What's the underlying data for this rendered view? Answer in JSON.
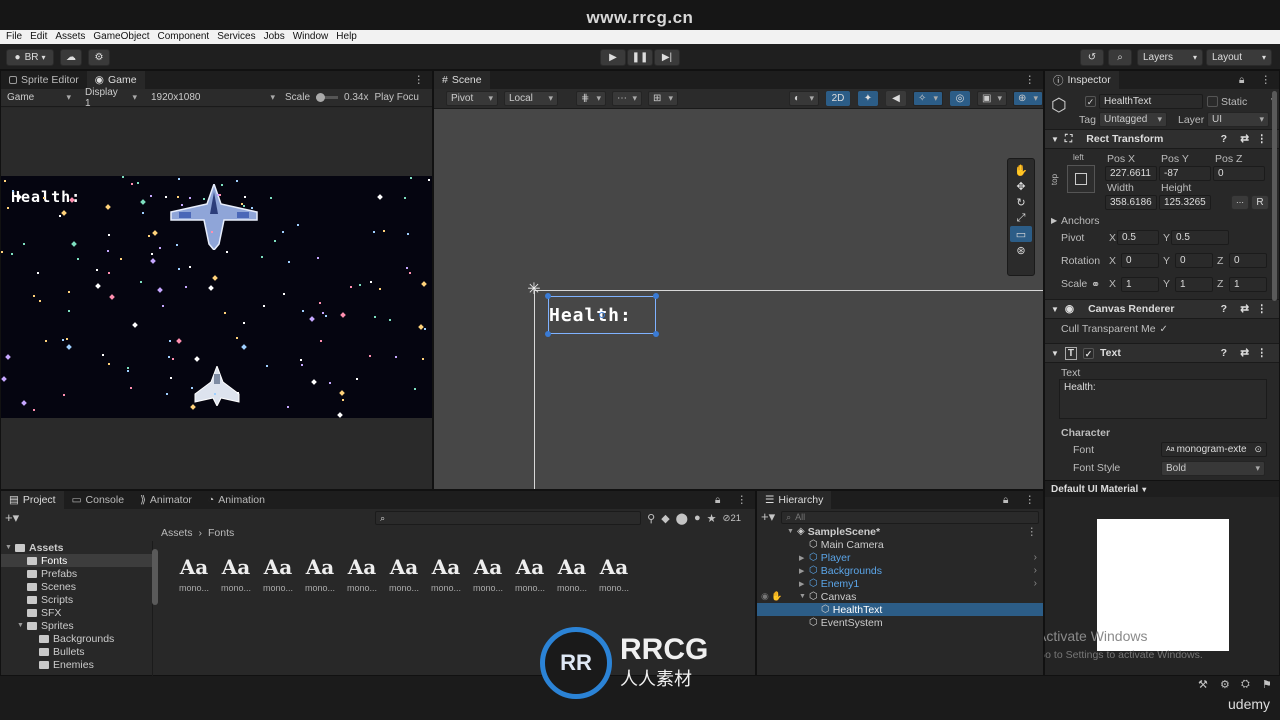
{
  "watermark": {
    "url": "www.rrcg.cn",
    "brand_title": "RRCG",
    "brand_sub": "人人素材",
    "udemy": "udemy"
  },
  "menu": [
    "File",
    "Edit",
    "Assets",
    "GameObject",
    "Component",
    "Services",
    "Jobs",
    "Window",
    "Help"
  ],
  "toolbar": {
    "account": "BR",
    "layers": "Layers",
    "layout": "Layout"
  },
  "game_panel": {
    "tabs": [
      "Sprite Editor",
      "Game"
    ],
    "mode": "Game",
    "display": "Display 1",
    "resolution": "1920x1080",
    "scale_label": "Scale",
    "scale_value": "0.34x",
    "play_focus": "Play Focu",
    "health_text": "Health:"
  },
  "scene_panel": {
    "tab": "Scene",
    "pivot": "Pivot",
    "local": "Local",
    "mode_2d": "2D",
    "health_text": "Health:"
  },
  "inspector": {
    "tab": "Inspector",
    "object_name": "HealthText",
    "static_label": "Static",
    "tag_label": "Tag",
    "tag_value": "Untagged",
    "layer_label": "Layer",
    "layer_value": "UI",
    "rect_transform": {
      "title": "Rect Transform",
      "anchor_h": "left",
      "anchor_v": "top",
      "pos_x_label": "Pos X",
      "pos_y_label": "Pos Y",
      "pos_z_label": "Pos Z",
      "pos_x": "227.6611",
      "pos_y": "-87",
      "pos_z": "0",
      "width_label": "Width",
      "height_label": "Height",
      "width": "358.6186",
      "height": "125.3265",
      "anchors": "Anchors",
      "pivot": "Pivot",
      "pivot_x": "0.5",
      "pivot_y": "0.5",
      "rotation": "Rotation",
      "rot_x": "0",
      "rot_y": "0",
      "rot_z": "0",
      "scale": "Scale",
      "scale_x": "1",
      "scale_y": "1",
      "scale_z": "1",
      "x": "X",
      "y": "Y",
      "z": "Z",
      "r": "R"
    },
    "canvas_renderer": {
      "title": "Canvas Renderer",
      "cull": "Cull Transparent Me"
    },
    "text": {
      "title": "Text",
      "text_label": "Text",
      "text_value": "Health:",
      "character": "Character",
      "font_label": "Font",
      "font_value": "monogram-exte",
      "font_style_label": "Font Style",
      "font_style_value": "Bold"
    },
    "default_material": "Default UI Material",
    "activate_title": "Activate Windows",
    "activate_sub": "Go to Settings to activate Windows."
  },
  "project_panel": {
    "tabs": [
      "Project",
      "Console",
      "Animator",
      "Animation"
    ],
    "badge": "21",
    "breadcrumb_root": "Assets",
    "breadcrumb_leaf": "Fonts",
    "tree": [
      {
        "label": "Assets",
        "indent": 0,
        "bold": true
      },
      {
        "label": "Fonts",
        "indent": 1,
        "selected": true
      },
      {
        "label": "Prefabs",
        "indent": 1
      },
      {
        "label": "Scenes",
        "indent": 1
      },
      {
        "label": "Scripts",
        "indent": 1
      },
      {
        "label": "SFX",
        "indent": 1
      },
      {
        "label": "Sprites",
        "indent": 1
      },
      {
        "label": "Backgrounds",
        "indent": 2
      },
      {
        "label": "Bullets",
        "indent": 2
      },
      {
        "label": "Enemies",
        "indent": 2
      }
    ],
    "font_glyph": "Aa",
    "font_names": [
      "mono...",
      "mono...",
      "mono...",
      "mono...",
      "mono...",
      "mono...",
      "mono...",
      "mono...",
      "mono...",
      "mono...",
      "mono..."
    ]
  },
  "hierarchy": {
    "tab": "Hierarchy",
    "search_placeholder": "All",
    "items": [
      {
        "label": "SampleScene*",
        "indent": 0,
        "bold": true
      },
      {
        "label": "Main Camera",
        "indent": 1
      },
      {
        "label": "Player",
        "indent": 1,
        "blue": true
      },
      {
        "label": "Backgrounds",
        "indent": 1,
        "blue": true
      },
      {
        "label": "Enemy1",
        "indent": 1,
        "blue": true
      },
      {
        "label": "Canvas",
        "indent": 1
      },
      {
        "label": "HealthText",
        "indent": 2,
        "selected": true
      },
      {
        "label": "EventSystem",
        "indent": 1
      }
    ]
  }
}
